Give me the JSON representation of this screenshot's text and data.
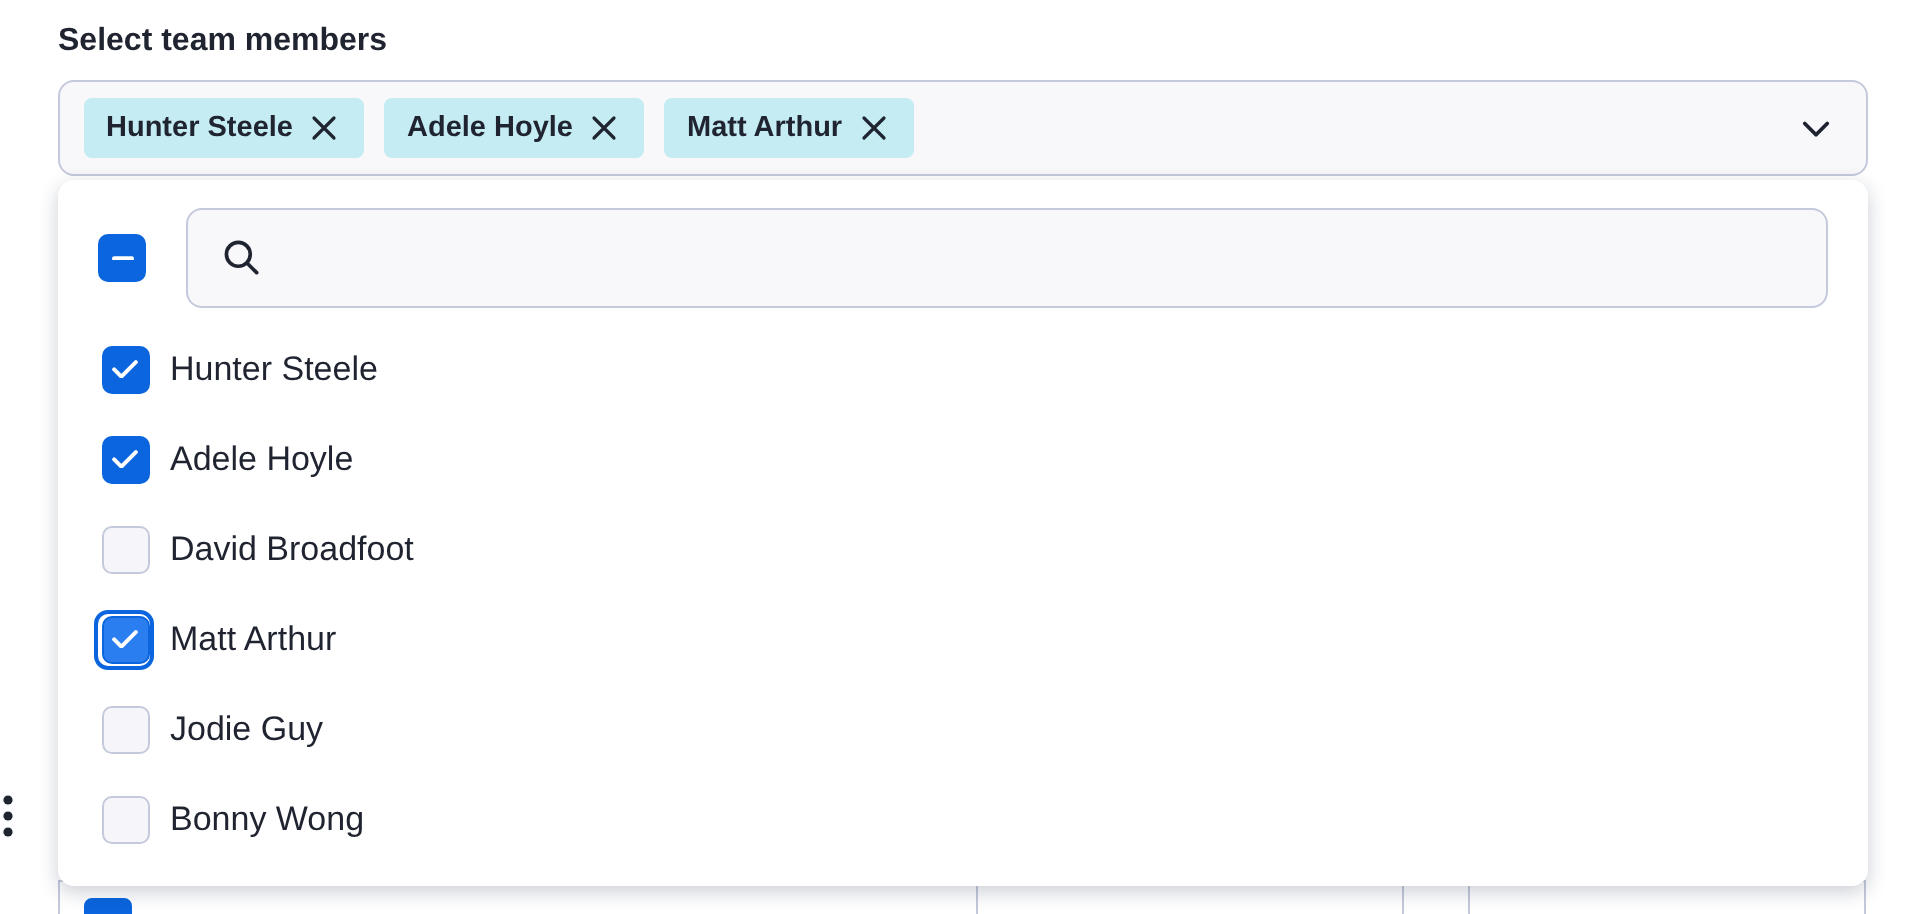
{
  "label": "Select team members",
  "chips": [
    {
      "label": "Hunter Steele"
    },
    {
      "label": "Adele Hoyle"
    },
    {
      "label": "Matt Arthur"
    }
  ],
  "select_all": {
    "indeterminate": true
  },
  "options": [
    {
      "label": "Hunter Steele",
      "checked": true,
      "focused": false
    },
    {
      "label": "Adele Hoyle",
      "checked": true,
      "focused": false
    },
    {
      "label": "David Broadfoot",
      "checked": false,
      "focused": false
    },
    {
      "label": "Matt Arthur",
      "checked": true,
      "focused": true
    },
    {
      "label": "Jodie Guy",
      "checked": false,
      "focused": false
    },
    {
      "label": "Bonny Wong",
      "checked": false,
      "focused": false
    }
  ],
  "background_row": {
    "checked": true
  }
}
